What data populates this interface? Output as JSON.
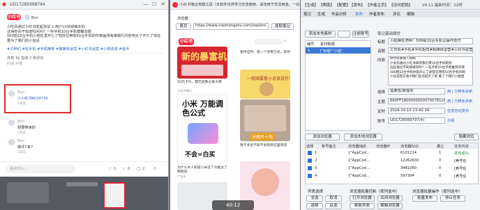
{
  "left": {
    "title": "UD17285698764",
    "post": {
      "author": "Bon",
      "lines": [
        "小吹风通过小红书发起测试 1 用户10块钱每天的",
        "这得你先不知道吗问问？一些手机10台手机模糊恐慌",
        "500拍10台手机小炮在发开心了啦现在用有50台手机的你家画场有谁我们问些吧大了不久了现在要为了我们的小说话",
        "小说话"
      ],
      "tags": "#工种们 #帖手机 #手机推荐 #做媒体运营 #小红书运营 #小类资源 #金币",
      "comment_title": "共有 3k 在线 2 条评论",
      "sort": "时间 对他"
    },
    "comments": [
      {
        "name": "Bon",
        "text": "小小红书6028735",
        "meta": "2天前"
      },
      {
        "name": "Bon",
        "text": "想要带来的",
        "meta": "2天前"
      },
      {
        "name": "Bon",
        "text": "微评7来7",
        "meta": "2天前"
      }
    ],
    "bottom": {
      "placeholder": "说点什么...",
      "likes": "1",
      "stars": "0",
      "comments": "2"
    }
  },
  "mid": {
    "window_title": "小红书笔记克隆工具（本软件仅供学习交流使用，请勿用于非法用途，一切后果由使用者承担）",
    "browser_label": "浏览器",
    "home": "首页",
    "url": "https://www.xiaohongshu.com/explore",
    "fetch": "提取笔记",
    "search_placeholder": "搜索小红书",
    "cards": [
      {
        "title": "新的暴富机会",
        "caption": "10元卡片，都无成数记录大佬",
        "author": "小红书笔记"
      },
      {
        "title": "",
        "caption": "家供应时，就一个买受方式，早你",
        "author": "作者"
      },
      {
        "title": "小米 万能调色公式",
        "caption": "一道简单的公式",
        "author": "小米"
      },
      {
        "title": "分娩开十指",
        "caption": "一般图要看小说读说开不知不觉在你大",
        "author": "摄影"
      },
      {
        "title": "",
        "caption": "为什么木人知道小米这个功能太了啊就说",
        "author": "广告员"
      },
      {
        "title": "不会=白买",
        "caption": "我不多出不知不会就到这里有的",
        "author": "作者"
      },
      {
        "title": "",
        "caption": "",
        "author": ""
      }
    ],
    "video_overlay": "40:12"
  },
  "right": {
    "menu": [
      "【生成】",
      "【帮助】",
      "【配置】",
      "【发布】",
      "【作者主页】",
      "【访问密钥】",
      "V4.11 最新时间：22时"
    ],
    "tabs_top": [
      "笔记",
      "生成",
      "作品分析",
      "发布",
      "作者发布",
      "评论",
      "编辑"
    ],
    "active_tab": "发布",
    "left_buttons": [
      "添加本地素材",
      "",
      "注册账号",
      "删除"
    ],
    "list_header": [
      "编号",
      "素材数据"
    ],
    "list_items": [
      "[\"标题\"\"小说\"",
      "",
      "",
      ""
    ],
    "form": {
      "section": "笔记基础属性",
      "title_label": "标题",
      "title_value": "小姑娘在洗啊！500租10台手机以操作技巧",
      "tags_label": "话题",
      "tags_value": "工作机#手机#手机矩阵#新媒体运营#小红书运营#",
      "content_label": "内容",
      "content_value": "你然有要我人啊啊\n小女孩通过小红书来到我们用10台手机跑到\n远远再也不知道被风吹？一些手机10台手机推荐的我\n500租10台手机你就开心了呢现在用有50台手机的啊\n小说说现实要#我们是也提示了呢 看了下我们小姐姐",
      "sync_label": "选择",
      "sync_value": "需要放/家落发",
      "topic_label": "主题",
      "topic_value": "660FF18000000000700781e5,15 奇面",
      "time_label": "定时",
      "time_value": "2024-10-10 23:42:34",
      "account_label": "账号",
      "account_value": "UD1728569797(4)",
      "right_links": [
        "用 | 分辨多多新",
        "用 | 分辨多多新",
        "用 | 分辨多多新",
        "任意自动发布",
        "任意时间字数",
        "分组"
      ]
    },
    "mid_buttons": [
      "添加浏览器",
      "添加本地浏览器",
      "隐藏浏览"
    ],
    "table": {
      "headers": [
        "选择",
        "账号备注",
        "浏览器指纹",
        "浏览器IP",
        "浏览器标识",
        "算止",
        "任务内容"
      ],
      "rows": [
        {
          "id": "1",
          "fp": "{\"AppCod...",
          "ip": "6101214",
          "flag": "1",
          "status": "发布成功",
          "extra": ""
        },
        {
          "id": "2",
          "fp": "{\"AppCod...",
          "ip": "12262630",
          "flag": "0",
          "status": "[养号任",
          "extra": ""
        },
        {
          "id": "3",
          "fp": "{\"AppCod...",
          "ip": "3481060",
          "flag": "0",
          "status": "[养号任",
          "extra": ""
        },
        {
          "id": "4",
          "fp": "{\"AppCod...",
          "ip": "597304",
          "flag": "0",
          "status": "[养号任",
          "extra": ""
        }
      ]
    },
    "bottom_groups": [
      "列表选择",
      "浏览器批量控制（按列选中）",
      "浏览器批量操作（按列选中）"
    ],
    "bottom_buttons": [
      "全选",
      "取消",
      "打开浏览器",
      "关闭浏览器",
      "批量发布",
      "停止任务",
      "选择",
      "反选",
      "刷新列表",
      "编辑浏览器"
    ]
  },
  "taskbar_caption": "编辑"
}
